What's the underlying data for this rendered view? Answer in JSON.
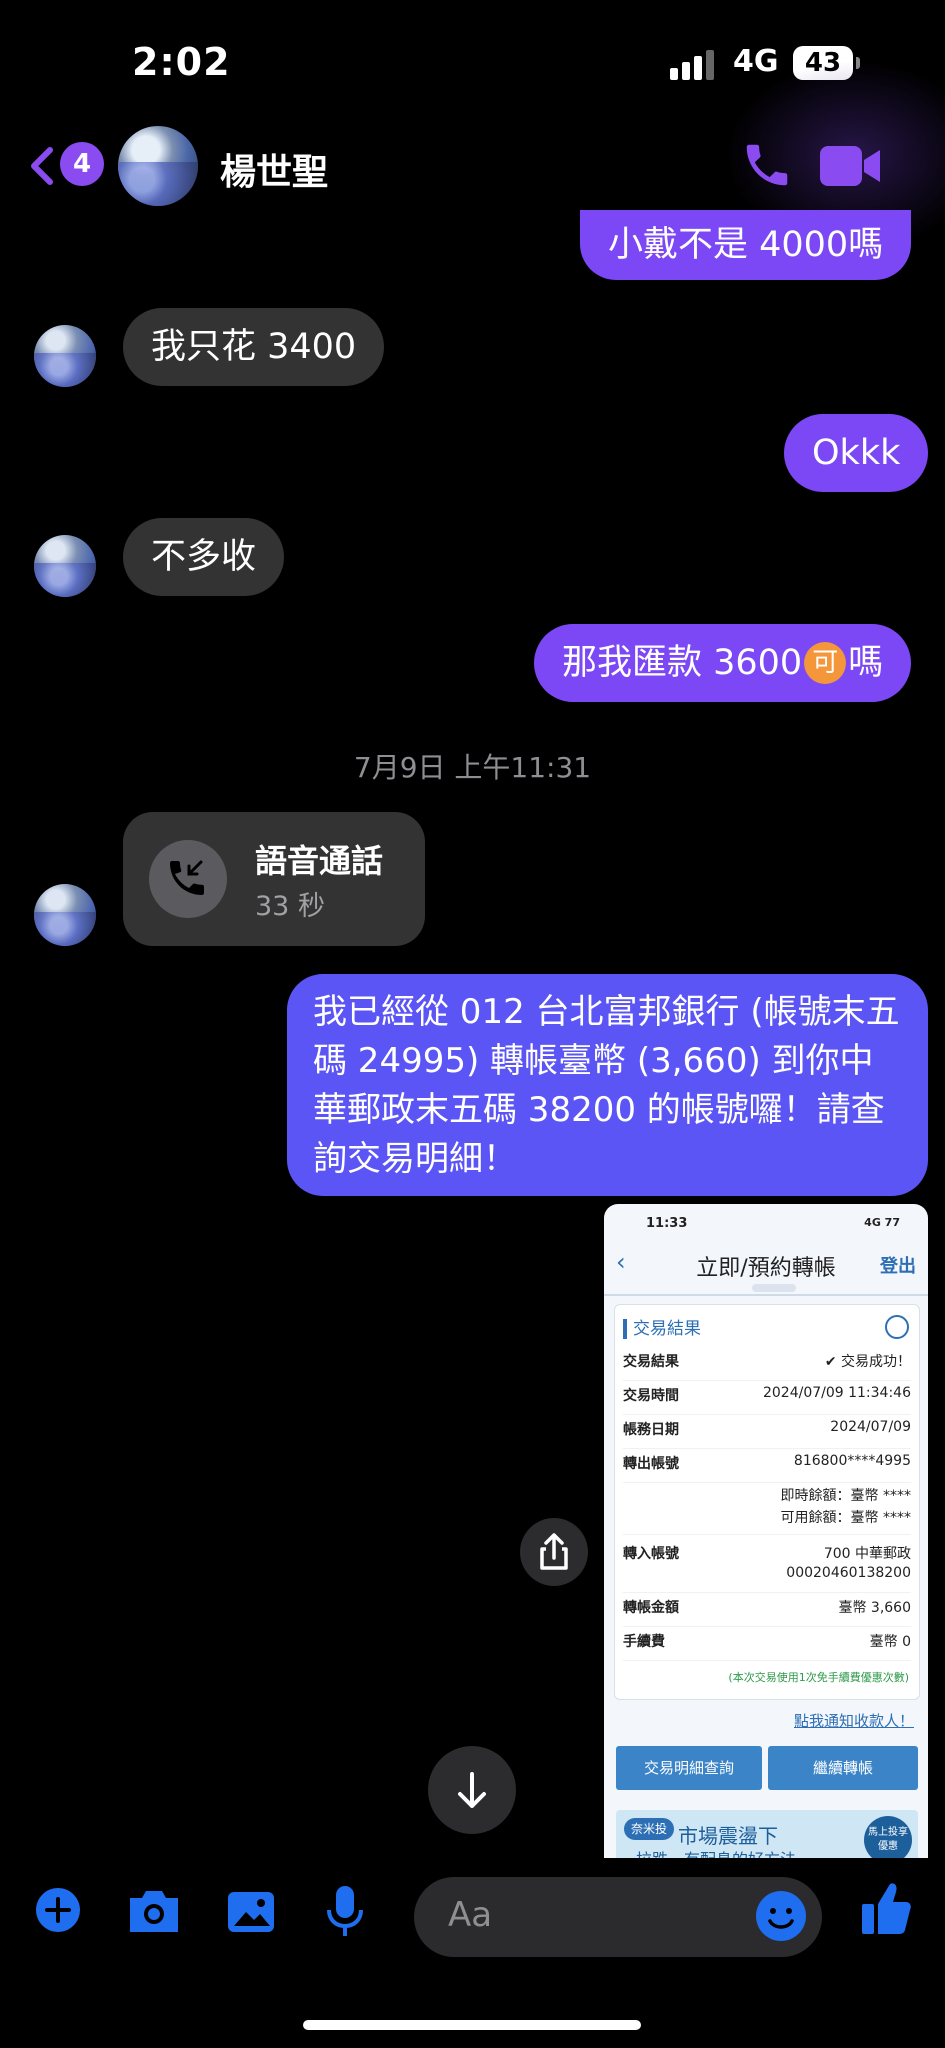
{
  "status_bar": {
    "time": "2:02",
    "network": "4G",
    "battery": "43"
  },
  "header": {
    "back_badge": "4",
    "contact_name": "楊世聖"
  },
  "messages": {
    "m1": "小戴不是 4000嗎",
    "m2": "我只花 3400",
    "m3": "Okkk",
    "m4": "不多收",
    "m5_pre": "那我匯款 3600",
    "m5_emoji": "可",
    "m5_post": "嗎",
    "timestamp": "7月9日 上午11:31",
    "call_title": "語音通話",
    "call_duration": "33 秒",
    "long_msg": "我已經從 012 台北富邦銀行 (帳號末五碼 24995) 轉帳臺幣 (3,660) 到你中華郵政末五碼 38200 的帳號囉！請查詢交易明細！"
  },
  "shot": {
    "time": "11:33",
    "status_right": "4G 77",
    "title": "立即/預約轉帳",
    "logout": "登出",
    "section": "交易結果",
    "rows": [
      {
        "k": "交易結果",
        "v": "✔ 交易成功！"
      },
      {
        "k": "交易時間",
        "v": "2024/07/09 11:34:46"
      },
      {
        "k": "帳務日期",
        "v": "2024/07/09"
      },
      {
        "k": "轉出帳號",
        "v": "816800****4995"
      },
      {
        "k": "",
        "v": "即時餘額：臺幣 ****"
      },
      {
        "k": "",
        "v": "可用餘額：臺幣 ****"
      },
      {
        "k": "轉入帳號",
        "v": "700 中華郵政"
      },
      {
        "k": "",
        "v": "00020460138200"
      },
      {
        "k": "轉帳金額",
        "v": "臺幣 3,660"
      },
      {
        "k": "手續費",
        "v": "臺幣 0"
      }
    ],
    "note": "(本次交易使用1次免手續費優惠次數)",
    "notify": "點我通知收款人！",
    "btn_detail": "交易明細查詢",
    "btn_continue": "繼續轉帳",
    "ad_logo": "奈米投",
    "ad_text": "市場震盪下",
    "ad_sub": "拉跌，有配息的好方法",
    "ad_badge": "馬上投享優惠"
  },
  "composer": {
    "placeholder": "Aa"
  },
  "colors": {
    "outgoing": "#7c48f5",
    "incoming": "#333333",
    "accent": "#1f6ef0"
  }
}
